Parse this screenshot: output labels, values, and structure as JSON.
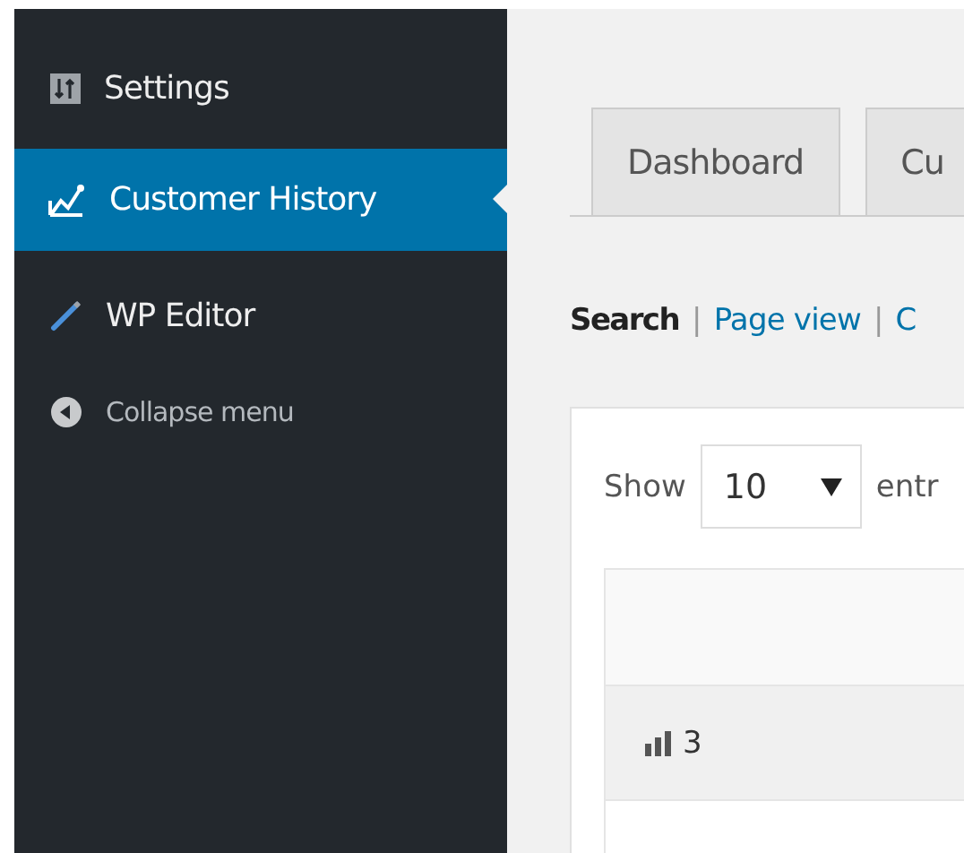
{
  "sidebar": {
    "items": [
      {
        "kind": "settings",
        "label": "Settings",
        "selected": false
      },
      {
        "kind": "history",
        "label": "Customer History",
        "selected": true
      },
      {
        "kind": "editor",
        "label": "WP Editor",
        "selected": false
      },
      {
        "kind": "collapse",
        "label": "Collapse menu",
        "selected": false
      }
    ]
  },
  "tabs": [
    {
      "label": "Dashboard",
      "selected": false
    },
    {
      "label": "Cu",
      "selected": false
    }
  ],
  "links": [
    {
      "label": "Search",
      "selected": true
    },
    {
      "label": "|",
      "kind": "separator"
    },
    {
      "label": "Page view",
      "selected": false
    },
    {
      "label": "|",
      "kind": "separator"
    },
    {
      "label": "C",
      "selected": false
    }
  ],
  "length_control": {
    "label": "Show",
    "value": "10",
    "suffix": "entr"
  },
  "table": {
    "rows": [
      {
        "cell": "3"
      },
      {
        "cell": ""
      }
    ]
  }
}
